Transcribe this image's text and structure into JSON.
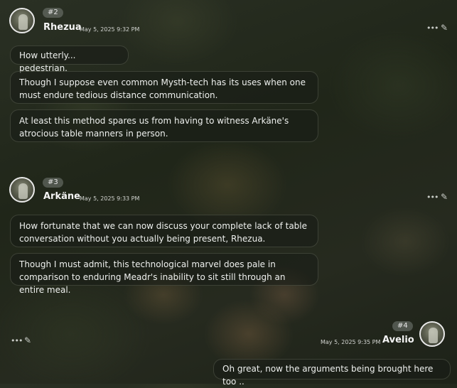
{
  "messages": [
    {
      "number": "#2",
      "author": "Rhezua",
      "timestamp": "May 5, 2025 9:32 PM",
      "lines": [
        "How utterly... pedestrian.",
        "Though I suppose even common Mysth-tech has its uses when one must endure tedious distance communication.",
        "At least this method spares us from having to witness Arkäne's atrocious table manners in person."
      ]
    },
    {
      "number": "#3",
      "author": "Arkäne",
      "timestamp": "May 5, 2025 9:33 PM",
      "lines": [
        "How fortunate that we can now discuss your complete lack of table conversation without you actually being present, Rhezua.",
        "Though I must admit, this technological marvel does pale in comparison to enduring Meadr's inability to sit still through an entire meal."
      ]
    },
    {
      "number": "#4",
      "author": "Avelio",
      "timestamp": "May 5, 2025 9:35 PM",
      "lines": [
        "Oh great, now the arguments being brought here too .."
      ]
    }
  ],
  "icons": {
    "more": "more-options-icon",
    "edit": "pencil-icon"
  }
}
